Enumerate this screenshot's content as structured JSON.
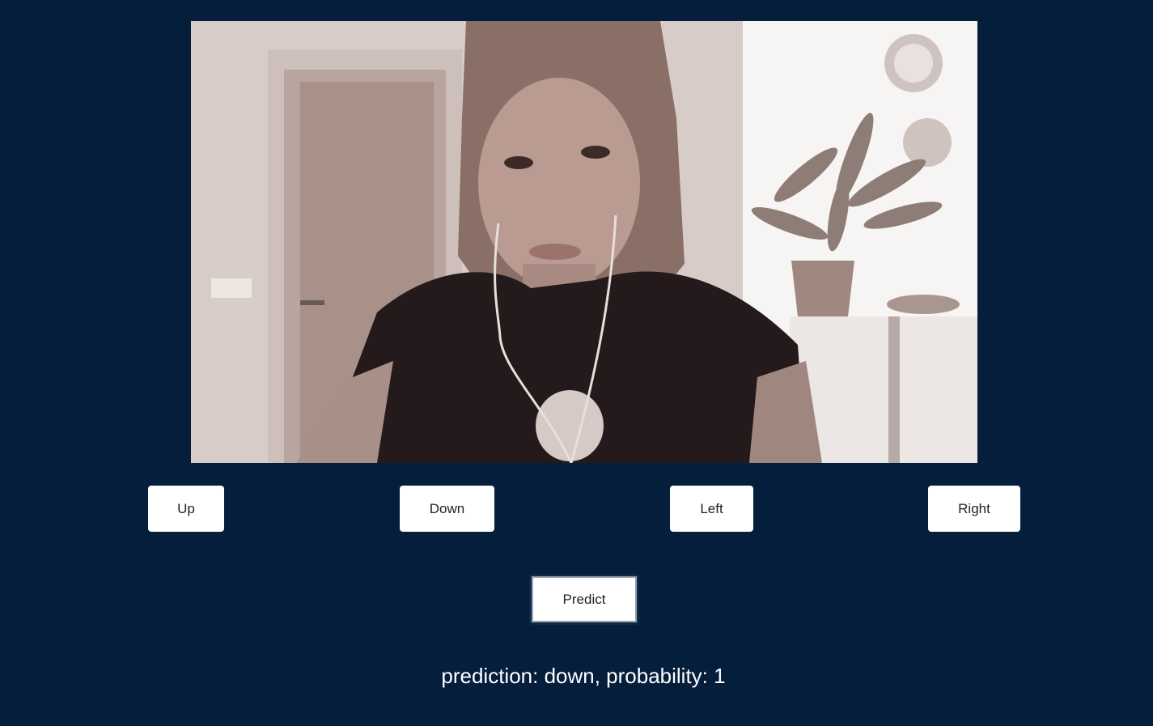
{
  "webcam": {
    "feed_description": "webcam-video-feed"
  },
  "training_buttons": {
    "up_label": "Up",
    "down_label": "Down",
    "left_label": "Left",
    "right_label": "Right"
  },
  "predict_button": {
    "label": "Predict"
  },
  "result": {
    "text": "prediction: down, probability: 1"
  },
  "colors": {
    "background": "#041e3b",
    "button_bg": "#ffffff",
    "text": "#ffffff"
  }
}
